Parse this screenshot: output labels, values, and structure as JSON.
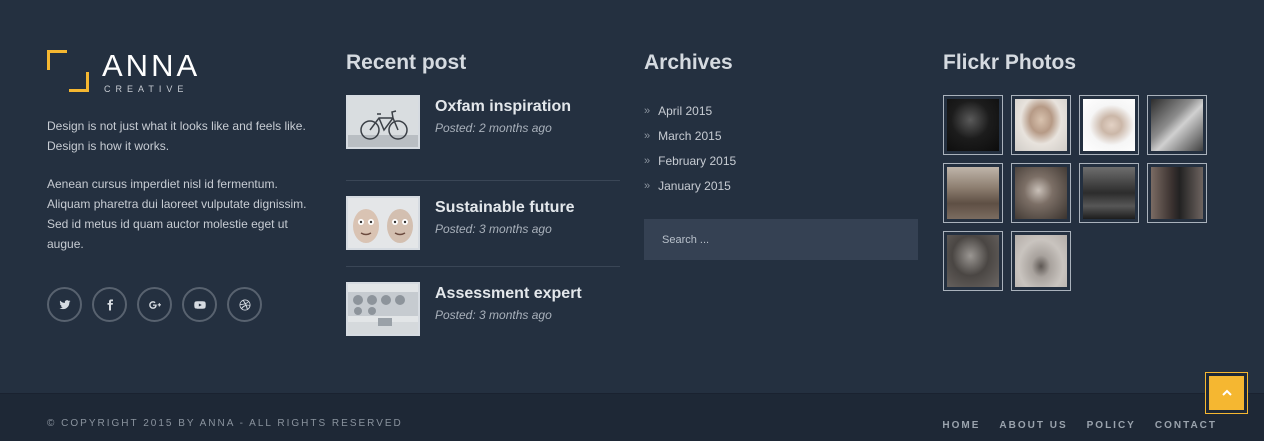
{
  "logo": {
    "name": "ANNA",
    "sub": "CREATIVE",
    "accent": "#f5b731"
  },
  "about": {
    "p1": "Design is not just what it looks like and feels like. Design is how it works.",
    "p2": "Aenean cursus imperdiet nisl id fermentum. Aliquam pharetra dui laoreet vulputate dignissim. Sed id metus id quam auctor molestie eget ut augue."
  },
  "socials": [
    "twitter-icon",
    "facebook-icon",
    "google-plus-icon",
    "youtube-icon",
    "dribbble-icon"
  ],
  "recent": {
    "title": "Recent post",
    "posts": [
      {
        "title": "Oxfam inspiration",
        "date": "Posted: 2 months ago"
      },
      {
        "title": "Sustainable future",
        "date": "Posted: 3 months ago"
      },
      {
        "title": "Assessment expert",
        "date": "Posted: 3 months ago"
      }
    ]
  },
  "archives": {
    "title": "Archives",
    "items": [
      "April 2015",
      "March 2015",
      "February 2015",
      "January 2015"
    ],
    "search_placeholder": "Search ..."
  },
  "flickr": {
    "title": "Flickr Photos"
  },
  "bottom": {
    "copyright": "© COPYRIGHT 2015 BY ANNA - ALL RIGHTS RESERVED",
    "nav": [
      "HOME",
      "ABOUT US",
      "POLICY",
      "CONTACT"
    ]
  }
}
